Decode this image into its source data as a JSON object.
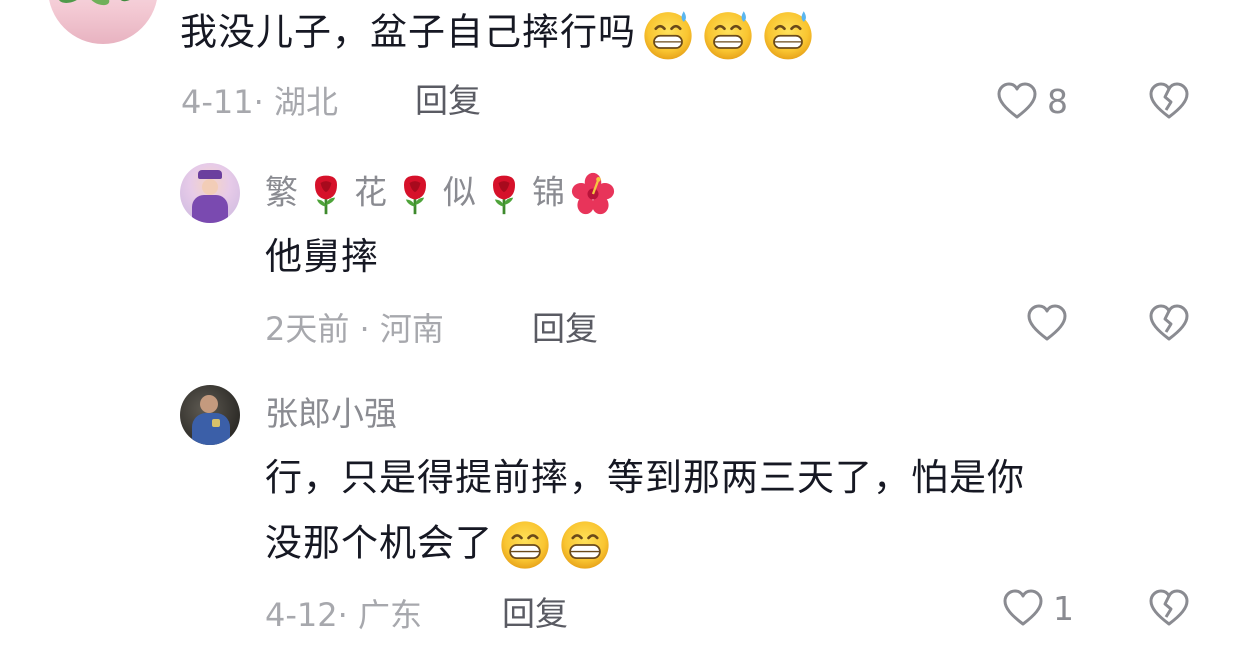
{
  "comments": [
    {
      "text": "我没儿子，盆子自己摔行吗",
      "emojis": [
        "grinning-sweat-emoji",
        "grinning-sweat-emoji",
        "grinning-sweat-emoji"
      ],
      "meta": "4-11· 湖北",
      "reply_label": "回复",
      "like_count": "8"
    },
    {
      "username_parts": [
        "繁",
        "花",
        "似",
        "锦"
      ],
      "username_emojis": [
        "rose-emoji",
        "rose-emoji",
        "rose-emoji",
        "hibiscus-emoji"
      ],
      "text": "他舅摔",
      "meta": "2天前 · 河南",
      "reply_label": "回复",
      "like_count": ""
    },
    {
      "username": "张郎小强",
      "text_line1": "行，只是得提前摔，等到那两三天了，怕是你",
      "text_line2": "没那个机会了",
      "emojis": [
        "grinning-emoji",
        "grinning-emoji"
      ],
      "meta": "4-12· 广东",
      "reply_label": "回复",
      "like_count": "1"
    }
  ],
  "icons": {
    "like": "heart-outline-icon",
    "dislike": "broken-heart-outline-icon"
  },
  "colors": {
    "text": "#161823",
    "username": "#8a8b91",
    "meta": "#a7a8ad",
    "reply": "#5a5b63",
    "icon": "#8a8b91"
  }
}
